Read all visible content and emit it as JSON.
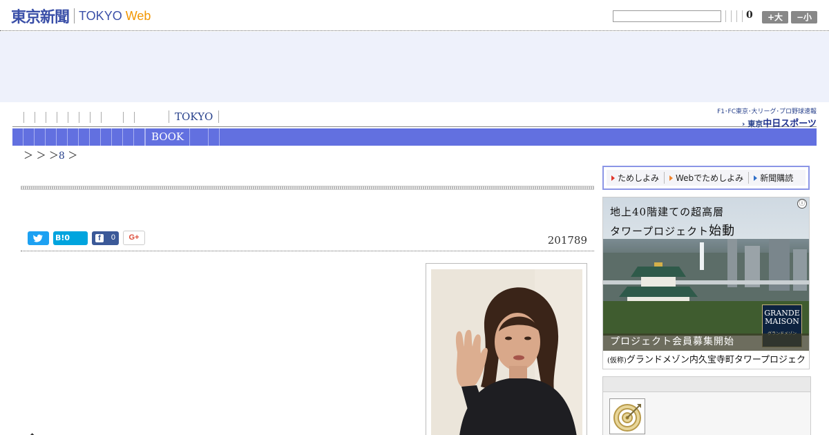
{
  "header": {
    "logo_jp": "東京新聞",
    "logo_tokyo": "TOKYO",
    "logo_web": "Web",
    "search_value": "",
    "count": "0",
    "size_up_label": "+大",
    "size_down_label": "−小"
  },
  "nav": {
    "tokyo_label": "TOKYO",
    "book_label": "BOOK",
    "chunichi_line1": "F1･FC東京･大リーグ･プロ野球速報",
    "chunichi_line2_prefix": "東京",
    "chunichi_line2_brand": "中日スポーツ"
  },
  "breadcrumb": {
    "sep1": "＞",
    "sep2": "＞",
    "sep3": "＞",
    "link": "8",
    "sep4": "＞"
  },
  "article": {
    "date": "201789",
    "hatena_label": "B!0",
    "facebook_count": "0",
    "gplus_label": "G+",
    "bottom_mark": "◆"
  },
  "sidebar": {
    "promo_items": [
      {
        "label": "ためしよみ",
        "color": "#e0362c"
      },
      {
        "label": "Webでためしよみ",
        "color": "#f0842d"
      },
      {
        "label": "新聞購読",
        "color": "#2f6fc8"
      }
    ],
    "ad": {
      "copy1": "地上40階建ての超高層",
      "copy2_prefix": "タワープロジェクト",
      "copy2_start": "始動",
      "brand1": "GRANDE",
      "brand2": "MAISON",
      "brand_jp": "グランドメゾン",
      "strip": "プロジェクト会員募集開始",
      "foot_small": "(仮称)",
      "foot_main": "グランドメゾン内久宝寺町タワープロジェクト",
      "info_icon": "ⓘ"
    }
  },
  "colors": {
    "brand_blue": "#3a4fa8",
    "web_orange": "#f29600",
    "nav_bar": "#6270e0"
  }
}
